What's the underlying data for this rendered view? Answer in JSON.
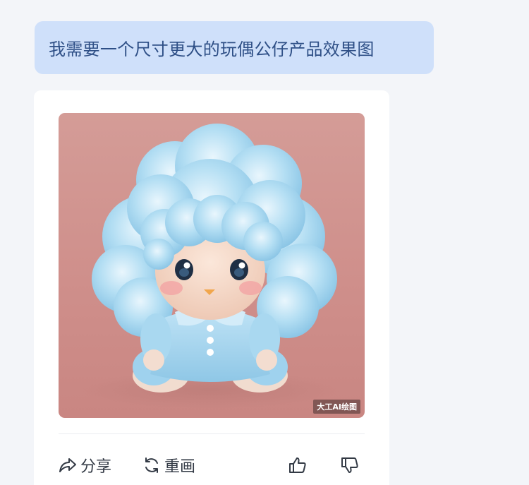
{
  "conversation": {
    "user_message": "我需要一个尺寸更大的玩偶公仔产品效果图"
  },
  "reply": {
    "image_alt": "蓝色棉花糖头发玩偶公仔",
    "watermark": "大工AI绘图"
  },
  "actions": {
    "share_label": "分享",
    "redraw_label": "重画",
    "share_icon": "share-icon",
    "redraw_icon": "refresh-icon",
    "like_icon": "thumbs-up-icon",
    "dislike_icon": "thumbs-down-icon"
  },
  "colors": {
    "page_background": "#f3f5f9",
    "user_bubble": "#cfe0fa",
    "user_text": "#2e4f86",
    "card_background": "#ffffff",
    "action_text": "#333a45"
  }
}
